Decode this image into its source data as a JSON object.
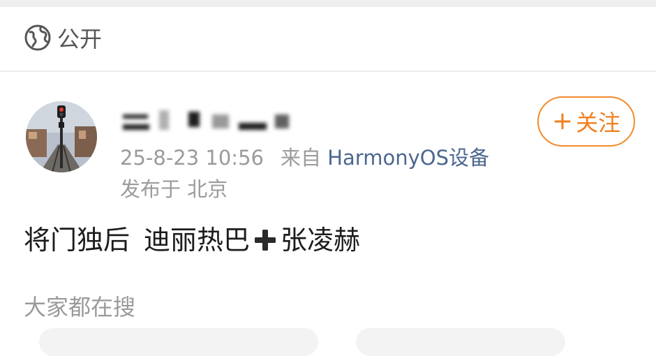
{
  "visibility": {
    "icon": "globe-icon",
    "label": "公开"
  },
  "author": {
    "avatar": "avatar"
  },
  "post_meta": {
    "timestamp": "25-8-23 10:56",
    "source_prefix": "来自",
    "source": "HarmonyOS设备",
    "location": "发布于 北京"
  },
  "follow_button": {
    "label": "关注"
  },
  "post": {
    "text_a": "将门独后",
    "text_b": "迪丽热巴",
    "text_c": "张凌赫"
  },
  "search": {
    "label": "大家都在搜"
  },
  "colors": {
    "accent": "#f07f1e",
    "link": "#4c678f",
    "muted": "#9b9b9b"
  }
}
